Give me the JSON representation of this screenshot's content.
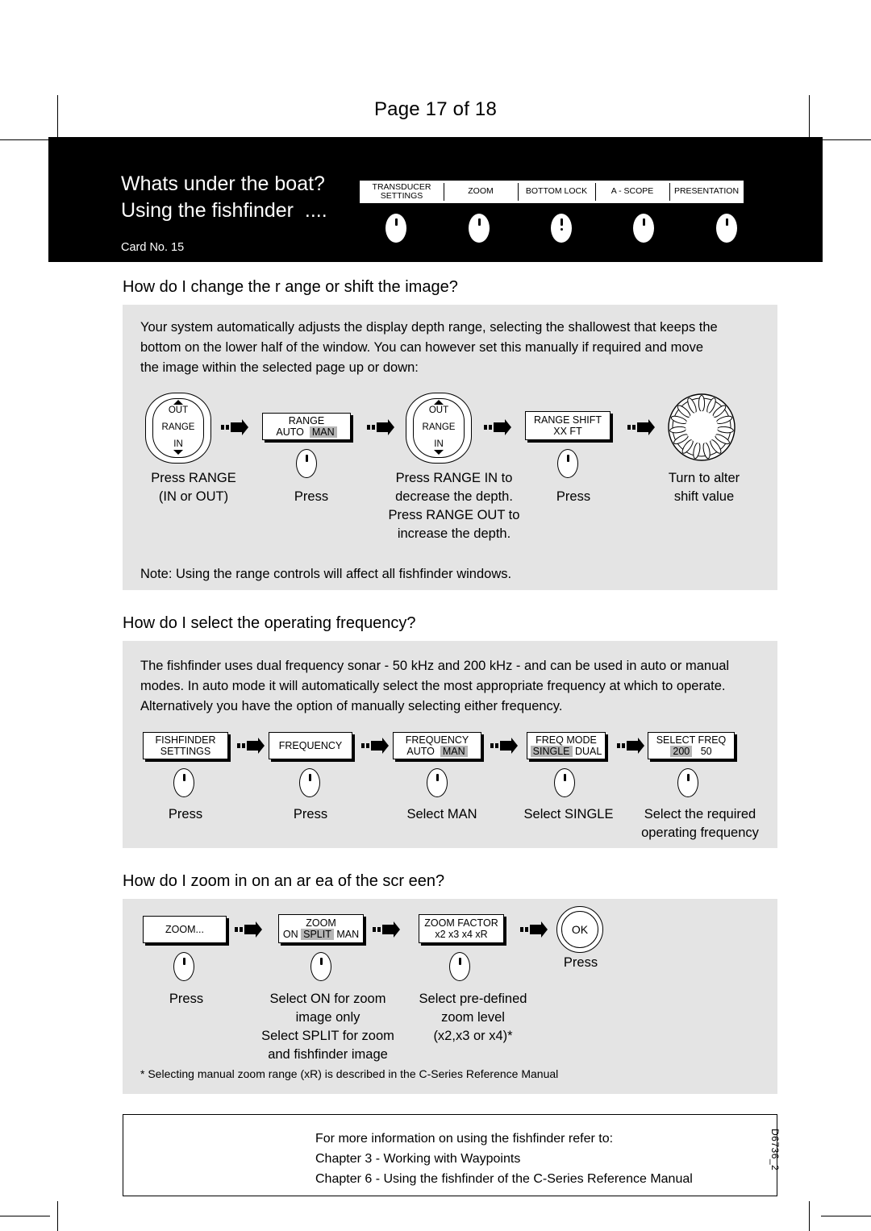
{
  "page": {
    "page_number_text": "Page 17 of 18",
    "doc_id": "D6736_2"
  },
  "banner": {
    "title_line1": "Whats under the boat?",
    "title_line2": "Using the fishfinder  ....",
    "card_label": "Card No. 15",
    "softkeys": [
      {
        "line1": "TRANSDUCER",
        "line2": "SETTINGS"
      },
      {
        "line1": "ZOOM",
        "line2": ""
      },
      {
        "line1": "BOTTOM LOCK",
        "line2": ""
      },
      {
        "line1": "A - SCOPE",
        "line2": ""
      },
      {
        "line1": "PRESENTATION",
        "line2": ""
      }
    ]
  },
  "section_range": {
    "heading": "How do I change the r ange or shift the image?",
    "body_line1": "Your system automatically adjusts the display depth range, selecting the shallowest that keeps the",
    "body_line2": "bottom on the lower half of the window. You can however set this manually if required and move",
    "body_line3": "the image within the selected page up or down:",
    "note": "Note: Using the range controls will affect all fishfinder windows.",
    "rocker1": {
      "top": "OUT",
      "middle": "RANGE",
      "bottom": "IN"
    },
    "rocker2": {
      "top": "OUT",
      "middle": "RANGE",
      "bottom": "IN"
    },
    "lcd_range": {
      "title": "RANGE",
      "opt_auto": "AUTO",
      "opt_man": "MAN",
      "highlighted": "MAN"
    },
    "lcd_shift": {
      "title": "RANGE SHIFT",
      "value": "XX FT"
    },
    "captions": {
      "c1_line1": "Press RANGE",
      "c1_line2": "(IN or OUT)",
      "c2": "Press",
      "c3_line1": "Press RANGE IN to",
      "c3_line2": "decrease the depth.",
      "c3_line3": "Press RANGE OUT to",
      "c3_line4": "increase the depth.",
      "c4": "Press",
      "c5_line1": "Turn to alter",
      "c5_line2": "shift value"
    }
  },
  "section_frequency": {
    "heading": "How do I select the operating frequency?",
    "body_line1": "The fishfinder uses dual frequency sonar - 50 kHz and 200 kHz - and can be used in auto or manual",
    "body_line2": "modes. In auto mode it will automatically select the most appropriate frequency at which to operate.",
    "body_line3": "Alternatively you have the option of manually selecting either frequency.",
    "lcd_fishfinder": {
      "line1": "FISHFINDER",
      "line2": "SETTINGS"
    },
    "lcd_frequency": {
      "line1": "FREQUENCY"
    },
    "lcd_freq_mode_auto_man": {
      "title": "FREQUENCY",
      "opt_auto": "AUTO",
      "opt_man": "MAN",
      "highlighted": "MAN"
    },
    "lcd_freq_mode": {
      "title": "FREQ MODE",
      "opt_single": "SINGLE",
      "opt_dual": "DUAL",
      "highlighted": "SINGLE"
    },
    "lcd_select_freq": {
      "title": "SELECT FREQ",
      "opt_200": "200",
      "opt_50": "50",
      "highlighted": "200"
    },
    "captions": {
      "c1": "Press",
      "c2": "Press",
      "c3": "Select MAN",
      "c4": "Select SINGLE",
      "c5_line1": "Select the required",
      "c5_line2": "operating frequency"
    }
  },
  "section_zoom": {
    "heading": "How do I zoom in on an ar ea of the scr een?",
    "lcd_zoom_menu": {
      "label": "ZOOM..."
    },
    "lcd_zoom_mode": {
      "title": "ZOOM",
      "opt_on": "ON",
      "opt_split": "SPLIT",
      "opt_man": "MAN",
      "highlighted": "SPLIT"
    },
    "lcd_zoom_factor": {
      "title": "ZOOM FACTOR",
      "opts": "x2   x3   x4   xR"
    },
    "ok_button": {
      "label": "OK"
    },
    "captions": {
      "c1": "Press",
      "c2_line1": "Select ON for zoom",
      "c2_line2": "image only",
      "c2_line3": "Select SPLIT for zoom",
      "c2_line4": "and fishfinder image",
      "c3_line1": "Select pre-defined",
      "c3_line2": "zoom level",
      "c3_line3": "(x2,x3 or x4)*",
      "c4": "Press"
    },
    "footnote": "* Selecting manual zoom range (xR) is described in the C-Series Reference Manual"
  },
  "reference_box": {
    "line1": "For more information on using the fishfinder refer to:",
    "line2": "Chapter 3 - Working with Waypoints",
    "line3": "Chapter 6 - Using the fishfinder of the C-Series Reference Manual"
  },
  "colors": {
    "panel_background": "#e4e4e4",
    "banner_background": "#000000",
    "highlight": "#b5b5b5"
  }
}
